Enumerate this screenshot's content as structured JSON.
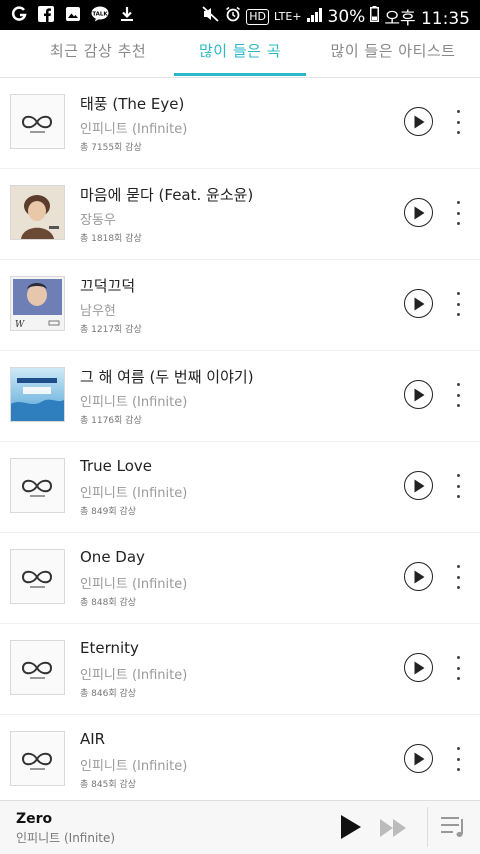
{
  "status": {
    "battery": "30%",
    "time": "오후 11:35",
    "network": "LTE+",
    "hd": "HD"
  },
  "tabs": [
    {
      "label": "최근 감상 추천"
    },
    {
      "label": "많이 들은 곡"
    },
    {
      "label": "많이 들은 아티스트"
    }
  ],
  "songs": [
    {
      "title": "태풍 (The Eye)",
      "artist": "인피니트 (Infinite)",
      "count": "총 7155회 감상"
    },
    {
      "title": "마음에 묻다 (Feat. 윤소윤)",
      "artist": "장동우",
      "count": "총 1818회 감상"
    },
    {
      "title": "끄덕끄덕",
      "artist": "남우현",
      "count": "총 1217회 감상"
    },
    {
      "title": "그 해 여름 (두 번째 이야기)",
      "artist": "인피니트 (Infinite)",
      "count": "총 1176회 감상"
    },
    {
      "title": "True Love",
      "artist": "인피니트 (Infinite)",
      "count": "총 849회 감상"
    },
    {
      "title": "One Day",
      "artist": "인피니트 (Infinite)",
      "count": "총 848회 감상"
    },
    {
      "title": "Eternity",
      "artist": "인피니트 (Infinite)",
      "count": "총 846회 감상"
    },
    {
      "title": "AIR",
      "artist": "인피니트 (Infinite)",
      "count": "총 845회 감상"
    }
  ],
  "player": {
    "title": "Zero",
    "artist": "인피니트 (Infinite)"
  },
  "colors": {
    "accent": "#2cb8c8"
  }
}
